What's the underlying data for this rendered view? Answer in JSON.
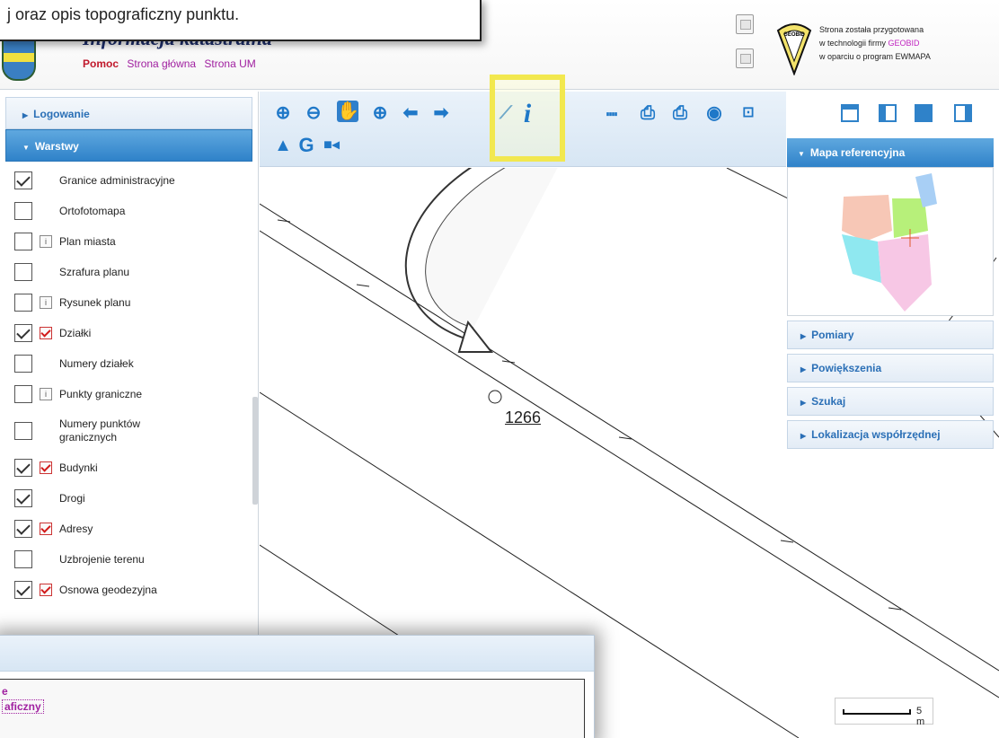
{
  "callout": {
    "text": "j oraz opis topograficzny punktu."
  },
  "header": {
    "title": "Informacja katastralna",
    "nav": [
      "Pomoc",
      "Strona główna",
      "Strona UM"
    ],
    "logo_text": "GEOBID",
    "credit_line1": "Strona została przygotowana",
    "credit_line2_pre": "w technologii firmy ",
    "credit_line2_hl": "GEOBID",
    "credit_line3": "w oparciu o program EWMAPA"
  },
  "left_panel": {
    "login_label": "Logowanie",
    "layers_label": "Warstwy",
    "layers": [
      {
        "label": "Granice administracyjne",
        "checked": true,
        "mini": "none"
      },
      {
        "label": "Ortofotomapa",
        "checked": false,
        "mini": "none"
      },
      {
        "label": "Plan miasta",
        "checked": false,
        "mini": "info"
      },
      {
        "label": "Szrafura planu",
        "checked": false,
        "mini": "none"
      },
      {
        "label": "Rysunek planu",
        "checked": false,
        "mini": "info"
      },
      {
        "label": "Działki",
        "checked": true,
        "mini": "red"
      },
      {
        "label": "Numery działek",
        "checked": false,
        "mini": "none"
      },
      {
        "label": "Punkty graniczne",
        "checked": false,
        "mini": "info"
      },
      {
        "label": "Numery punktów granicznych",
        "checked": false,
        "mini": "none"
      },
      {
        "label": "Budynki",
        "checked": true,
        "mini": "red"
      },
      {
        "label": "Drogi",
        "checked": true,
        "mini": "none"
      },
      {
        "label": "Adresy",
        "checked": true,
        "mini": "red"
      },
      {
        "label": "Uzbrojenie terenu",
        "checked": false,
        "mini": "none"
      },
      {
        "label": "Osnowa geodezyjna",
        "checked": true,
        "mini": "red"
      }
    ]
  },
  "toolbar": {
    "icons": [
      "zoom-in-icon",
      "zoom-out-icon",
      "pan-hand-icon",
      "zoom-window-icon",
      "back-arrow-icon",
      "forward-arrow-icon",
      "measure-icon",
      "info-icon",
      "ruler-icon",
      "print-icon",
      "print-preview-icon",
      "globe-icon",
      "export-icon",
      "warning-icon",
      "google-icon",
      "camera-icon"
    ]
  },
  "map": {
    "point_label": "1266",
    "scale_label": "5 m"
  },
  "right_panel": {
    "ref_map_label": "Mapa referencyjna",
    "items": [
      "Pomiary",
      "Powiększenia",
      "Szukaj",
      "Lokalizacja współrzędnej"
    ]
  },
  "popup": {
    "line1": "e",
    "line2": "aficzny"
  },
  "colors": {
    "accent": "#2f82c9",
    "highlight": "#f2e84f",
    "link": "#a020a0",
    "help": "#c0182b"
  }
}
